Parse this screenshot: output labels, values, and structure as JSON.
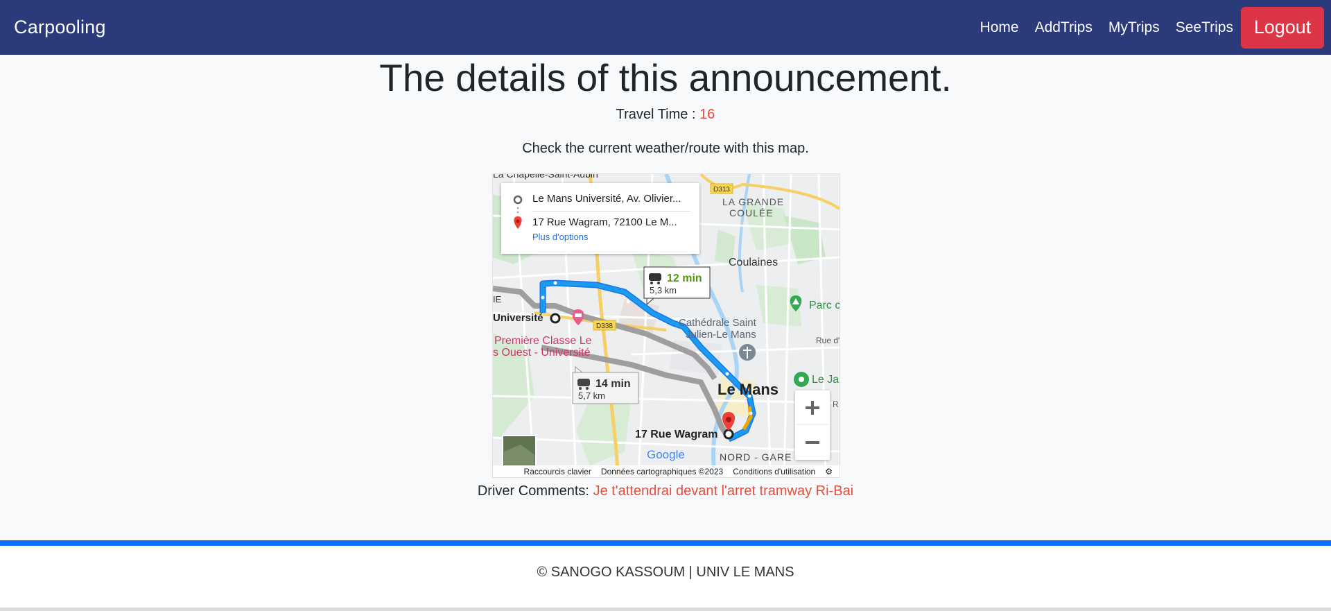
{
  "navbar": {
    "brand": "Carpooling",
    "links": [
      "Home",
      "AddTrips",
      "MyTrips",
      "SeeTrips"
    ],
    "logout_label": "Logout"
  },
  "page": {
    "title": "The details of this announcement.",
    "travel_time_label": "Travel Time : ",
    "travel_time_value": "16",
    "map_caption": "Check the current weather/route with this map.",
    "driver_comments_label": "Driver Comments: ",
    "driver_comments_value": "Je t'attendrai devant l'arret tramway Ri-Bai"
  },
  "map": {
    "origin": "Le Mans Université, Av. Olivier...",
    "destination": "17 Rue Wagram, 72100 Le M...",
    "more_options": "Plus d'options",
    "route_main": {
      "time": "12 min",
      "distance": "5,3 km"
    },
    "route_alt": {
      "time": "14 min",
      "distance": "5,7 km"
    },
    "labels": {
      "top": "La Chapelle-Saint-Aubin",
      "grande": "LA GRANDE",
      "coulee": "COULÉE",
      "coulaines": "Coulaines",
      "parc": "Parc c",
      "universite": "Université",
      "premiere1": "Première Classe Le",
      "premiere2": "s Ouest - Université",
      "cathedrale1": "Cathédrale Saint",
      "cathedrale2": "Julien-Le Mans",
      "lemans": "Le Mans",
      "wagram": "17 Rue Wagram",
      "nord": "NORD - GARE",
      "ie": "IE",
      "rue": "Rue d'",
      "leja": "Le Ja",
      "r": "R",
      "d313": "D313",
      "d338": "D338",
      "google": "Google"
    },
    "footer": {
      "shortcuts": "Raccourcis clavier",
      "data": "Données cartographiques ©2023",
      "terms": "Conditions d'utilisation"
    },
    "colors": {
      "route": "#1a9bf0",
      "alt_route": "#a9a9a9",
      "pin": "#ea4335",
      "time_green": "#34a853"
    }
  },
  "footer": {
    "text": "© SANOGO KASSOUM | UNIV LE MANS"
  },
  "colors": {
    "navbar_bg": "#2b3a7a",
    "logout_bg": "#dc3545",
    "accent_text": "#e74c3c",
    "footer_border": "#0d6efd"
  }
}
